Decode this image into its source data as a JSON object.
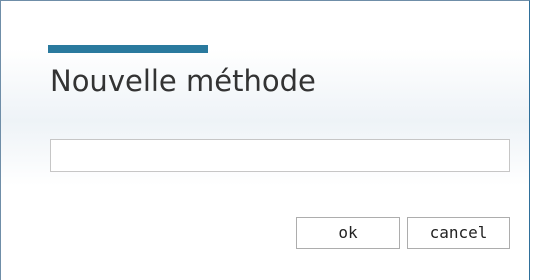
{
  "dialog": {
    "title": "Nouvelle méthode",
    "input": {
      "value": "",
      "placeholder": ""
    },
    "buttons": {
      "ok_label": "ok",
      "cancel_label": "cancel"
    }
  },
  "colors": {
    "accent": "#2a7a9e",
    "border": "#2f6f9a",
    "title_text": "#333333"
  }
}
